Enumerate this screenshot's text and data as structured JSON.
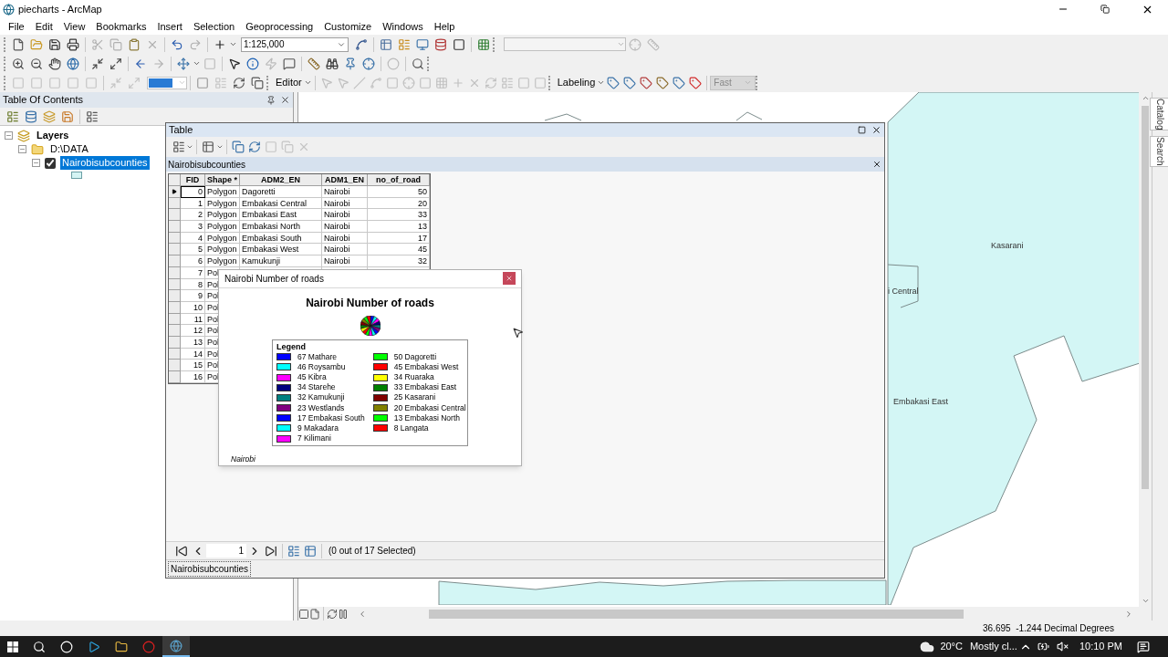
{
  "window": {
    "title": "piecharts - ArcMap"
  },
  "menu": [
    "File",
    "Edit",
    "View",
    "Bookmarks",
    "Insert",
    "Selection",
    "Geoprocessing",
    "Customize",
    "Windows",
    "Help"
  ],
  "toolbar": {
    "scale": "1:125,000",
    "editor": "Editor",
    "labeling": "Labeling",
    "label_speed": "Fast"
  },
  "toc": {
    "title": "Table Of Contents",
    "tree": [
      {
        "kind": "frame",
        "label": "Layers",
        "expanded": true,
        "children": [
          {
            "kind": "folder",
            "label": "D:\\DATA",
            "expanded": true,
            "children": [
              {
                "kind": "layer",
                "label": "Nairobisubcounties",
                "expanded": true,
                "checked": true,
                "selected": true
              }
            ]
          }
        ]
      }
    ]
  },
  "map": {
    "labels": [
      "Kasarani",
      "i Central",
      "Embakasi East"
    ]
  },
  "side_tabs": [
    "Catalog",
    "Search"
  ],
  "table_window": {
    "title": "Table",
    "layer_tab": "Nairobisubcounties",
    "columns": [
      "FID",
      "Shape *",
      "ADM2_EN",
      "ADM1_EN",
      "no_of_road"
    ],
    "rows": [
      {
        "current": true,
        "cells": [
          "0",
          "Polygon",
          "Dagoretti",
          "Nairobi",
          "50"
        ]
      },
      {
        "current": false,
        "cells": [
          "1",
          "Polygon",
          "Embakasi Central",
          "Nairobi",
          "20"
        ]
      },
      {
        "current": false,
        "cells": [
          "2",
          "Polygon",
          "Embakasi East",
          "Nairobi",
          "33"
        ]
      },
      {
        "current": false,
        "cells": [
          "3",
          "Polygon",
          "Embakasi North",
          "Nairobi",
          "13"
        ]
      },
      {
        "current": false,
        "cells": [
          "4",
          "Polygon",
          "Embakasi South",
          "Nairobi",
          "17"
        ]
      },
      {
        "current": false,
        "cells": [
          "5",
          "Polygon",
          "Embakasi West",
          "Nairobi",
          "45"
        ]
      },
      {
        "current": false,
        "cells": [
          "6",
          "Polygon",
          "Kamukunji",
          "Nairobi",
          "32"
        ]
      },
      {
        "current": false,
        "cells": [
          "7",
          "Pol"
        ]
      },
      {
        "current": false,
        "cells": [
          "8",
          "Pol"
        ]
      },
      {
        "current": false,
        "cells": [
          "9",
          "Pol"
        ]
      },
      {
        "current": false,
        "cells": [
          "10",
          "Pol"
        ]
      },
      {
        "current": false,
        "cells": [
          "11",
          "Pol"
        ]
      },
      {
        "current": false,
        "cells": [
          "12",
          "Pol"
        ]
      },
      {
        "current": false,
        "cells": [
          "13",
          "Pol"
        ]
      },
      {
        "current": false,
        "cells": [
          "14",
          "Pol"
        ]
      },
      {
        "current": false,
        "cells": [
          "15",
          "Pol"
        ]
      },
      {
        "current": false,
        "cells": [
          "16",
          "Pol"
        ]
      }
    ],
    "page": "1",
    "selection_count": "(0 out of 17 Selected)",
    "bottom_tab": "Nairobisubcounties"
  },
  "popup": {
    "title": "Nairobi Number of roads",
    "chart_title": "Nairobi Number of roads",
    "legend_title": "Legend",
    "footer": "Nairobi",
    "legend_columns": [
      [
        {
          "label": "67 Mathare",
          "color": "#0000ff"
        },
        {
          "label": "46 Roysambu",
          "color": "#00ffff"
        },
        {
          "label": "45 Kibra",
          "color": "#ff00ff"
        },
        {
          "label": "34 Starehe",
          "color": "#000080"
        },
        {
          "label": "32 Kamukunji",
          "color": "#008080"
        },
        {
          "label": "23 Westlands",
          "color": "#800080"
        },
        {
          "label": "17 Embakasi South",
          "color": "#0000fe"
        },
        {
          "label": "9 Makadara",
          "color": "#00fffe"
        },
        {
          "label": "7 Kilimani",
          "color": "#fe00ff"
        }
      ],
      [
        {
          "label": "50 Dagoretti",
          "color": "#00ff00"
        },
        {
          "label": "45 Embakasi West",
          "color": "#ff0000"
        },
        {
          "label": "34 Ruaraka",
          "color": "#ffff00"
        },
        {
          "label": "33 Embakasi East",
          "color": "#008000"
        },
        {
          "label": "25 Kasarani",
          "color": "#800000"
        },
        {
          "label": "20 Embakasi Central",
          "color": "#808000"
        },
        {
          "label": "13 Embakasi North",
          "color": "#00fe00"
        },
        {
          "label": "8 Langata",
          "color": "#fe0000"
        }
      ]
    ]
  },
  "status_bar": {
    "coordinates": "36.695  -1.244 Decimal Degrees"
  },
  "taskbar": {
    "temperature": "20°C",
    "weather": "Mostly cl...",
    "time": "10:10 PM"
  }
}
